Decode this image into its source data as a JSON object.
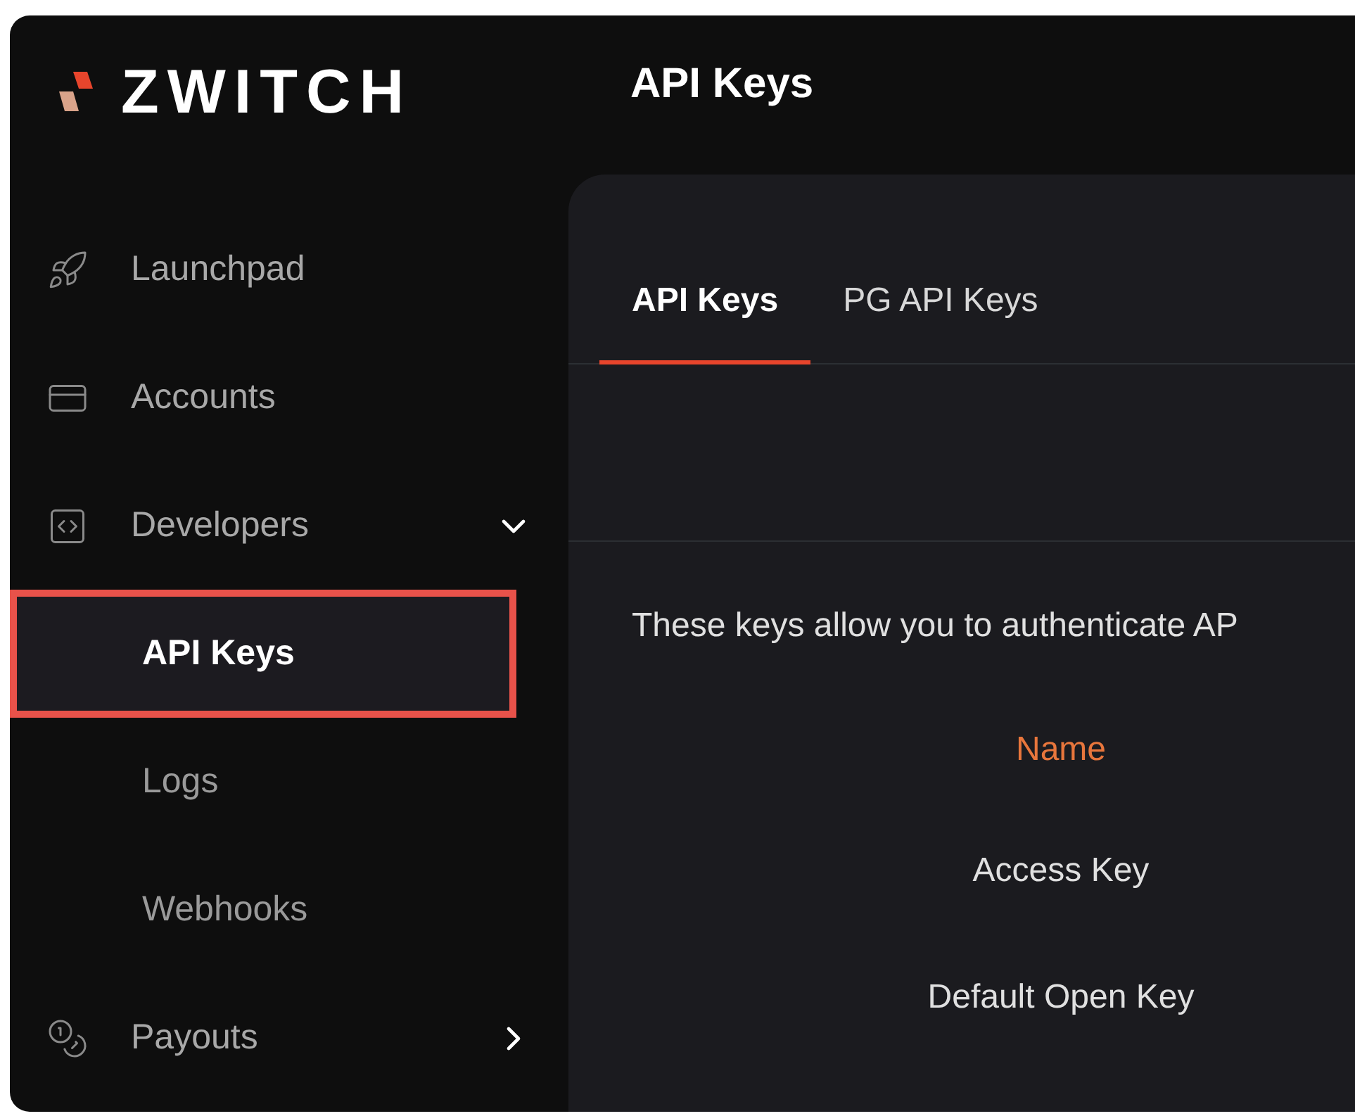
{
  "logo": {
    "text": "ZWITCH"
  },
  "header": {
    "title": "API Keys"
  },
  "sidebar": {
    "items": [
      {
        "label": "Launchpad",
        "kind": "rocket"
      },
      {
        "label": "Accounts",
        "kind": "cards"
      },
      {
        "label": "Developers",
        "kind": "code",
        "expanded": true,
        "children": [
          {
            "label": "API Keys",
            "selected": true,
            "highlighted": true
          },
          {
            "label": "Logs",
            "selected": false,
            "highlighted": false
          },
          {
            "label": "Webhooks",
            "selected": false,
            "highlighted": false
          }
        ]
      },
      {
        "label": "Payouts",
        "kind": "coins",
        "expanded": false
      }
    ]
  },
  "tabs": [
    {
      "label": "API Keys",
      "selected": true
    },
    {
      "label": "PG API Keys",
      "selected": false
    }
  ],
  "description": "These keys allow you to authenticate AP",
  "key_table": {
    "header": "Name",
    "rows": [
      "Access Key",
      "Default Open Key"
    ]
  }
}
